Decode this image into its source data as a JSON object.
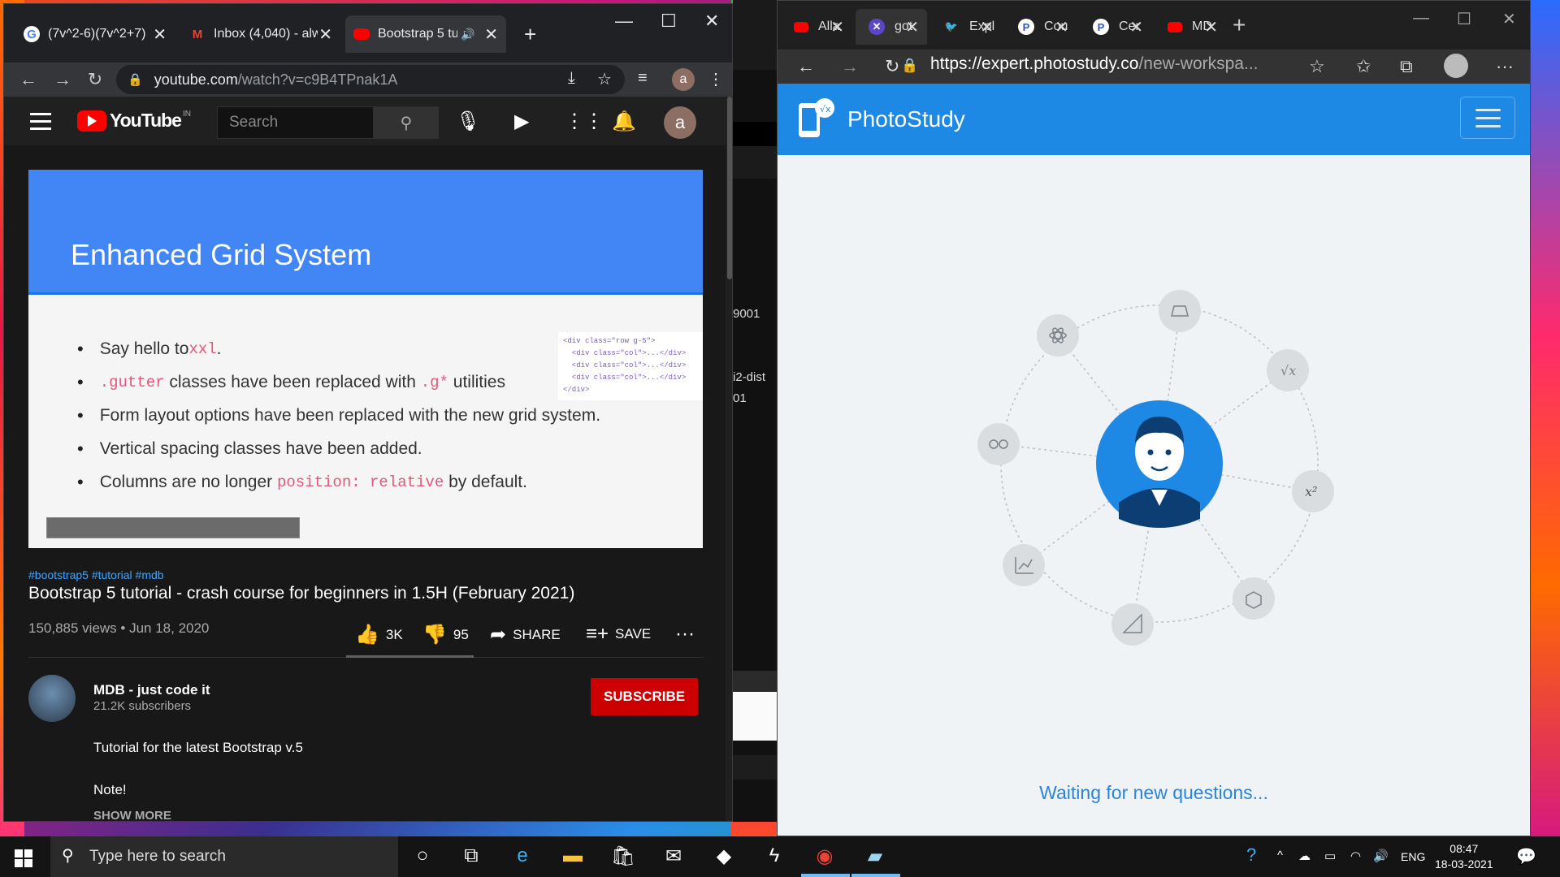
{
  "chrome": {
    "tabs": [
      {
        "label": "(7v^2-6)(7v^2+7)",
        "icon": "google-icon"
      },
      {
        "label": "Inbox (4,040) - alw",
        "icon": "gmail-icon"
      },
      {
        "label": "Bootstrap 5 tu",
        "icon": "youtube-icon",
        "active": true
      }
    ],
    "url_host": "youtube.com",
    "url_path": "/watch?v=c9B4TPnak1A"
  },
  "youtube": {
    "logo": "YouTube",
    "country": "IN",
    "search_placeholder": "Search",
    "avatar_letter": "a",
    "slide": {
      "title": "Enhanced Grid System",
      "code": "<div class=\"row g-5\">\n  <div class=\"col\">...</div>\n  <div class=\"col\">...</div>\n  <div class=\"col\">...</div>\n</div>",
      "bullets": [
        {
          "pre": "Say hello to ",
          "code": "xxl",
          "post": "."
        },
        {
          "pre": "",
          "code": ".gutter",
          "post": " classes have been replaced with ",
          "code2": ".g*",
          "post2": " utilities"
        },
        {
          "pre": "Form layout options have been replaced with the new grid system.",
          "code": "",
          "post": ""
        },
        {
          "pre": "Vertical spacing classes have been added.",
          "code": "",
          "post": ""
        },
        {
          "pre": "Columns are no longer ",
          "code": "position: relative",
          "post": " by default."
        }
      ]
    },
    "hashtags": "#bootstrap5 #tutorial #mdb",
    "title": "Bootstrap 5 tutorial - crash course for beginners in 1.5H (February 2021)",
    "views": "150,885 views • Jun 18, 2020",
    "likes": "3K",
    "dislikes": "95",
    "share": "SHARE",
    "save": "SAVE",
    "channel": "MDB - just code it",
    "subscribers": "21.2K subscribers",
    "subscribe": "SUBSCRIBE",
    "desc_line1": "Tutorial for the latest Bootstrap v.5",
    "desc_line2": "Note!",
    "show_more": "SHOW MORE"
  },
  "peek": {
    "t1": "9001",
    "t2": "i2-dist",
    "t3": "01"
  },
  "edge": {
    "tabs": [
      {
        "label": "Alla",
        "color": "#ff0000"
      },
      {
        "label": "got",
        "color": "#7b5cff",
        "active": true
      },
      {
        "label": "Expl",
        "color": "#1da1f2"
      },
      {
        "label": "Cou",
        "color": "#2d55c8"
      },
      {
        "label": "Cer",
        "color": "#2d55c8"
      },
      {
        "label": "MD",
        "color": "#ff0000"
      }
    ],
    "url_host": "https://expert.photostudy.co",
    "url_path": "/new-workspa..."
  },
  "photostudy": {
    "brand": "PhotoStudy",
    "waiting": "Waiting for new questions...",
    "subject_icons": [
      "atom-icon",
      "geometry-icon",
      "sqrt-icon",
      "glasses-icon",
      "x-squared-icon",
      "graph-icon",
      "cube-icon",
      "triangle-icon"
    ],
    "label_x2": "x²",
    "label_sqrt": "√x"
  },
  "taskbar": {
    "search_placeholder": "Type here to search",
    "lang": "ENG",
    "time": "08:47",
    "date": "18-03-2021"
  }
}
